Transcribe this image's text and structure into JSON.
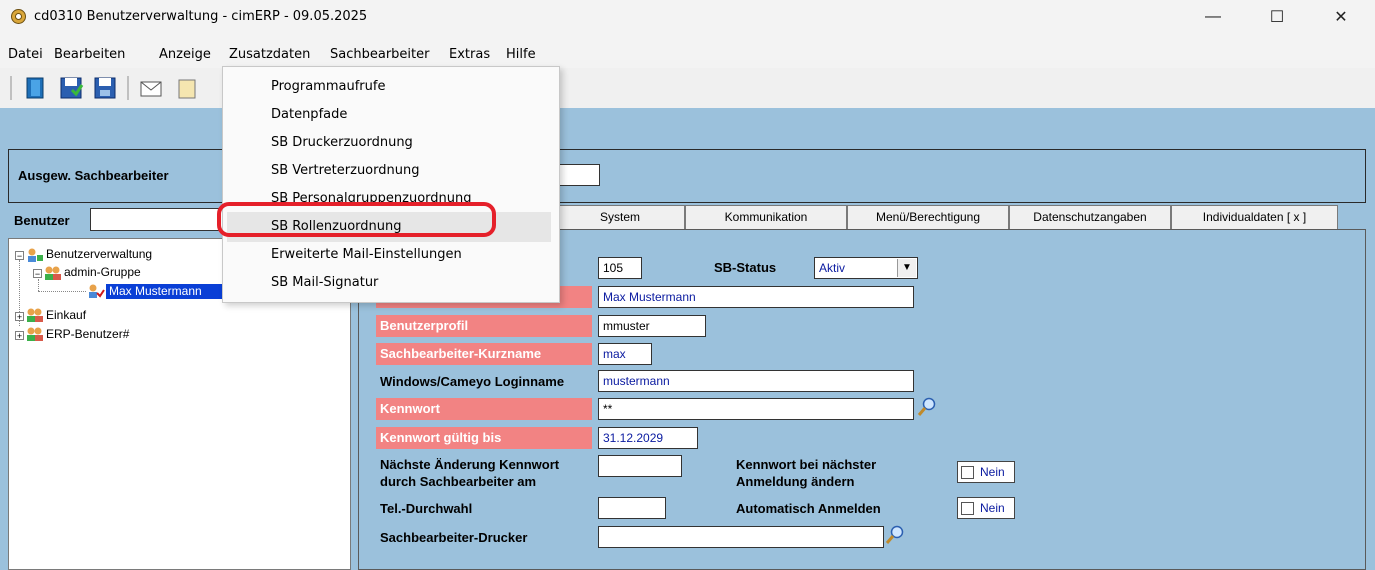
{
  "window": {
    "title": "cd0310 Benutzerverwaltung - cimERP - 09.05.2025",
    "minimize": "—",
    "maximize": "☐",
    "close": "✕"
  },
  "menubar": [
    "Datei",
    "Bearbeiten",
    "Anzeige",
    "Zusatzdaten",
    "Sachbearbeiter",
    "Extras",
    "Hilfe"
  ],
  "dropdown": {
    "items": [
      "Programmaufrufe",
      "Datenpfade",
      "SB Druckerzuordnung",
      "SB Vertreterzuordnung",
      "SB Personalgruppenzuordnung",
      "SB Rollenzuordnung",
      "Erweiterte Mail-Einstellungen",
      "SB Mail-Signatur"
    ],
    "highlighted": "SB Rollenzuordnung"
  },
  "header": {
    "label": "Ausgew. Sachbearbeiter",
    "value": ""
  },
  "benutzer": {
    "label": "Benutzer",
    "value": ""
  },
  "tree": {
    "root": "Benutzerverwaltung",
    "group1": "admin-Gruppe",
    "selected_user": "Max Mustermann",
    "group2": "Einkauf",
    "group3": "ERP-Benutzer#"
  },
  "tabs": [
    "System",
    "Kommunikation",
    "Menü/Berechtigung",
    "Datenschutzangaben",
    "Individualdaten [ x ]"
  ],
  "form": {
    "id_value": "105",
    "status_label": "SB-Status",
    "status_value": "Aktiv",
    "name_value": "Max Mustermann",
    "profil_label": "Benutzerprofil",
    "profil_value": "mmuster",
    "kurzname_label": "Sachbearbeiter-Kurzname",
    "kurzname_value": "max",
    "login_label": "Windows/Cameyo Loginname",
    "login_value": "mustermann",
    "kennwort_label": "Kennwort",
    "kennwort_value": "**",
    "gueltig_label": "Kennwort gültig bis",
    "gueltig_value": "31.12.2029",
    "naechste_label_1": "Nächste Änderung Kennwort",
    "naechste_label_2": "durch Sachbearbeiter am",
    "naechste_value": "",
    "aendern_label_1": "Kennwort bei nächster",
    "aendern_label_2": "Anmeldung ändern",
    "aendern_value": "Nein",
    "tel_label": "Tel.-Durchwahl",
    "tel_value": "",
    "auto_label": "Automatisch Anmelden",
    "auto_value": "Nein",
    "drucker_label": "Sachbearbeiter-Drucker",
    "drucker_value": ""
  },
  "colors": {
    "content_bg": "#9bc1dc",
    "label_red": "#f28383",
    "highlight_ring": "#e5202a",
    "selection": "#0a3fd6"
  }
}
